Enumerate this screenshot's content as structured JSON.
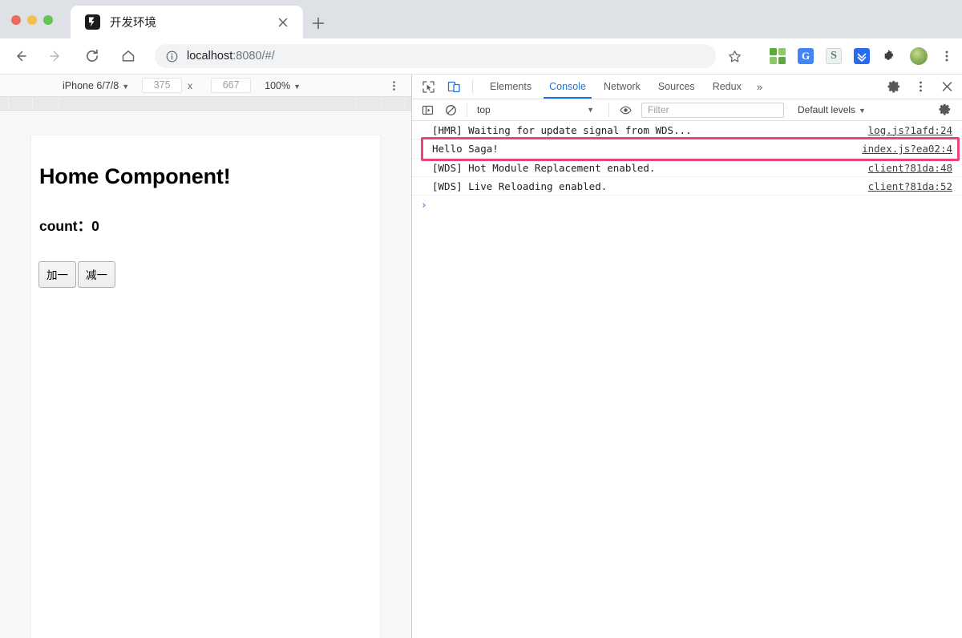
{
  "window": {
    "traffic_lights": [
      "close",
      "minimize",
      "maximize"
    ],
    "colors": {
      "red": "#ed6a5e",
      "yellow": "#f5bf4f",
      "green": "#61c454"
    }
  },
  "tabstrip": {
    "tab_title": "开发环境",
    "favicon_name": "app-favicon",
    "close_label": "×",
    "newtab_label": "+"
  },
  "omnibox": {
    "url_host": "localhost",
    "url_rest": ":8080/#/",
    "info_icon": "info-icon",
    "star_icon": "bookmark-star-icon",
    "back_icon": "back-arrow-icon",
    "forward_icon": "forward-arrow-icon",
    "reload_icon": "reload-icon",
    "home_icon": "home-icon",
    "extensions": [
      {
        "name": "qr-code-extension-icon",
        "label": ""
      },
      {
        "name": "google-translate-extension-icon",
        "label": "G"
      },
      {
        "name": "grammar-extension-icon",
        "label": "S"
      },
      {
        "name": "download-extension-icon",
        "label": ""
      },
      {
        "name": "puzzle-extensions-icon",
        "label": ""
      }
    ],
    "avatar_name": "profile-avatar",
    "menu_icon": "chrome-menu-kebab-icon"
  },
  "device_toolbar": {
    "device": "iPhone 6/7/8",
    "width": "375",
    "height": "667",
    "x_label": "x",
    "zoom": "100%",
    "caret": "▼",
    "kebab_icon": "device-toolbar-more-icon"
  },
  "page": {
    "heading": "Home Component!",
    "count_label": "count：0",
    "buttons": [
      {
        "name": "increment-button",
        "label": "加一"
      },
      {
        "name": "decrement-button",
        "label": "减一"
      }
    ]
  },
  "devtools": {
    "inspect_icon": "inspect-element-icon",
    "device_toggle_icon": "toggle-device-toolbar-icon",
    "tabs": [
      {
        "label": "Elements",
        "active": false
      },
      {
        "label": "Console",
        "active": true
      },
      {
        "label": "Network",
        "active": false
      },
      {
        "label": "Sources",
        "active": false
      },
      {
        "label": "Redux",
        "active": false
      }
    ],
    "more_tabs": "»",
    "settings_icon": "devtools-settings-gear-icon",
    "kebab_icon": "devtools-more-options-icon",
    "close_icon": "devtools-close-icon",
    "console_toolbar": {
      "sidebar_icon": "console-sidebar-toggle-icon",
      "clear_icon": "clear-console-icon",
      "context": "top",
      "context_caret": "▼",
      "eye_icon": "live-expression-eye-icon",
      "filter_placeholder": "Filter",
      "filter_value": "",
      "levels": "Default levels",
      "levels_caret": "▼",
      "settings_icon": "console-settings-gear-icon"
    },
    "console_messages": [
      {
        "text": "[HMR] Waiting for update signal from WDS...",
        "source": "log.js?1afd:24",
        "highlighted": false
      },
      {
        "text": "Hello Saga!",
        "source": "index.js?ea02:4",
        "highlighted": true
      },
      {
        "text": "[WDS] Hot Module Replacement enabled.",
        "source": "client?81da:48",
        "highlighted": false
      },
      {
        "text": "[WDS] Live Reloading enabled.",
        "source": "client?81da:52",
        "highlighted": false
      }
    ],
    "prompt": "›",
    "highlight_color": "#e8447e"
  }
}
